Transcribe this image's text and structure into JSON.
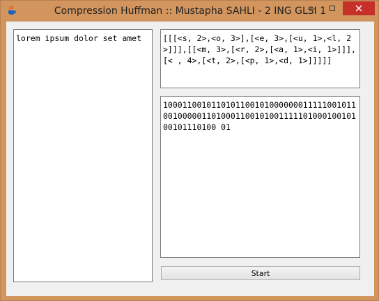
{
  "window": {
    "title": "Compression Huffman :: Mustapha SAHLI - 2 ING GLSI 1",
    "app_icon": "java-cup-icon",
    "buttons": {
      "minimize": "minimize-icon",
      "maximize": "maximize-icon",
      "close": "close-icon"
    }
  },
  "input": {
    "text": "lorem ipsum dolor set amet"
  },
  "tree": {
    "text": "[[[<s, 2>,<o, 3>],[<e, 3>,[<u, 1>,<l, 2>]]],[[<m, 3>,[<r, 2>,[<a, 1>,<i, 1>]]],[< , 4>,[<t, 2>,[<p, 1>,<d, 1>]]]]]"
  },
  "encoded": {
    "text": "1000110010110101100101000000011111001011001000001101000110010100111110100010010100101110100 01"
  },
  "start_button": {
    "label": "Start"
  },
  "colors": {
    "frame": "#d2955e",
    "close": "#c7302a",
    "client": "#f0f0f0"
  }
}
